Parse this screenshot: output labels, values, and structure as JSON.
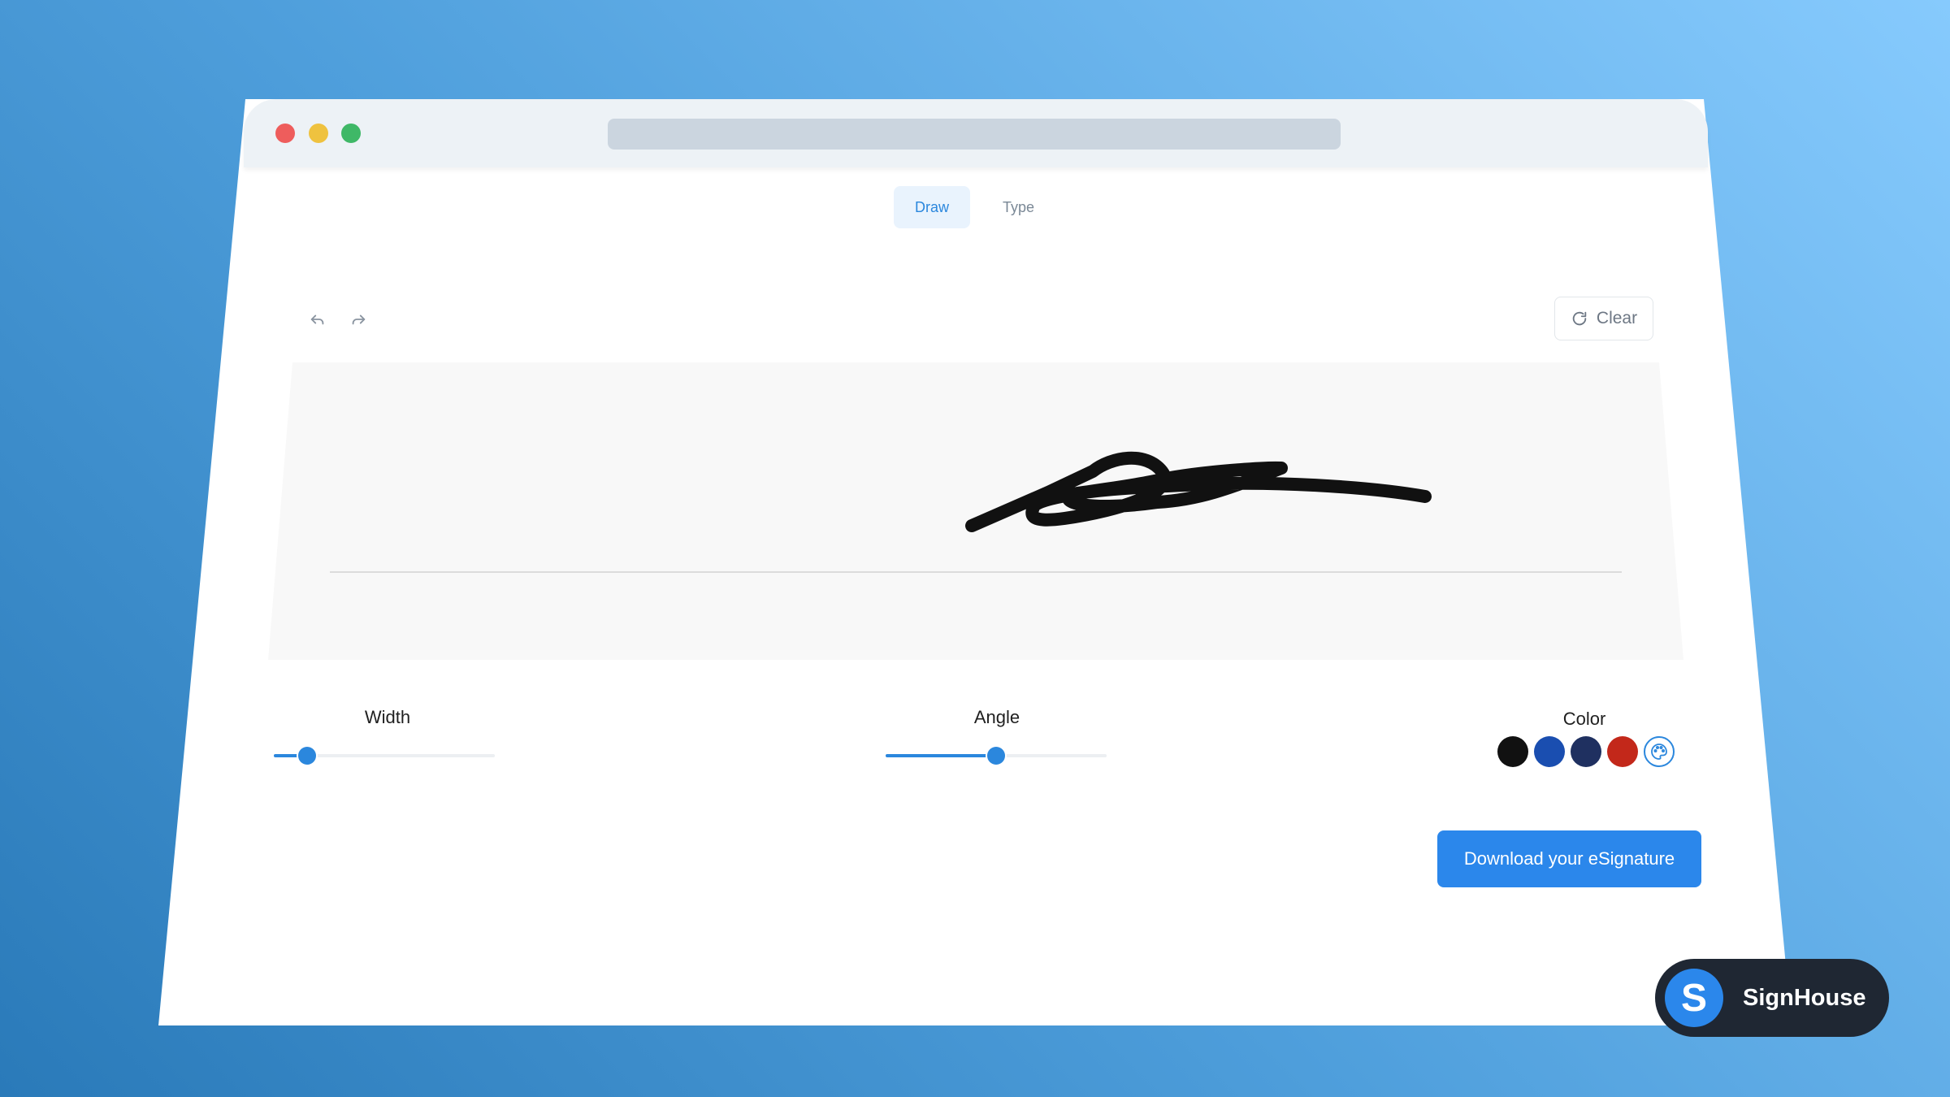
{
  "tabs": [
    {
      "label": "Draw",
      "active": true
    },
    {
      "label": "Type",
      "active": false
    }
  ],
  "toolbar": {
    "undo_icon": "undo-icon",
    "redo_icon": "redo-icon",
    "clear_label": "Clear",
    "clear_icon": "eraser-icon"
  },
  "controls": {
    "width": {
      "label": "Width",
      "value_fraction": 0.15
    },
    "angle": {
      "label": "Angle",
      "value_fraction": 0.5
    },
    "color": {
      "label": "Color",
      "swatches": [
        "#111111",
        "#1a4eb0",
        "#1f3060",
        "#c3281a"
      ],
      "custom_icon": "palette-icon",
      "accent": "#2b87dd"
    }
  },
  "download_label": "Download your eSignature",
  "brand": {
    "logo_letter": "S",
    "name": "SignHouse"
  }
}
